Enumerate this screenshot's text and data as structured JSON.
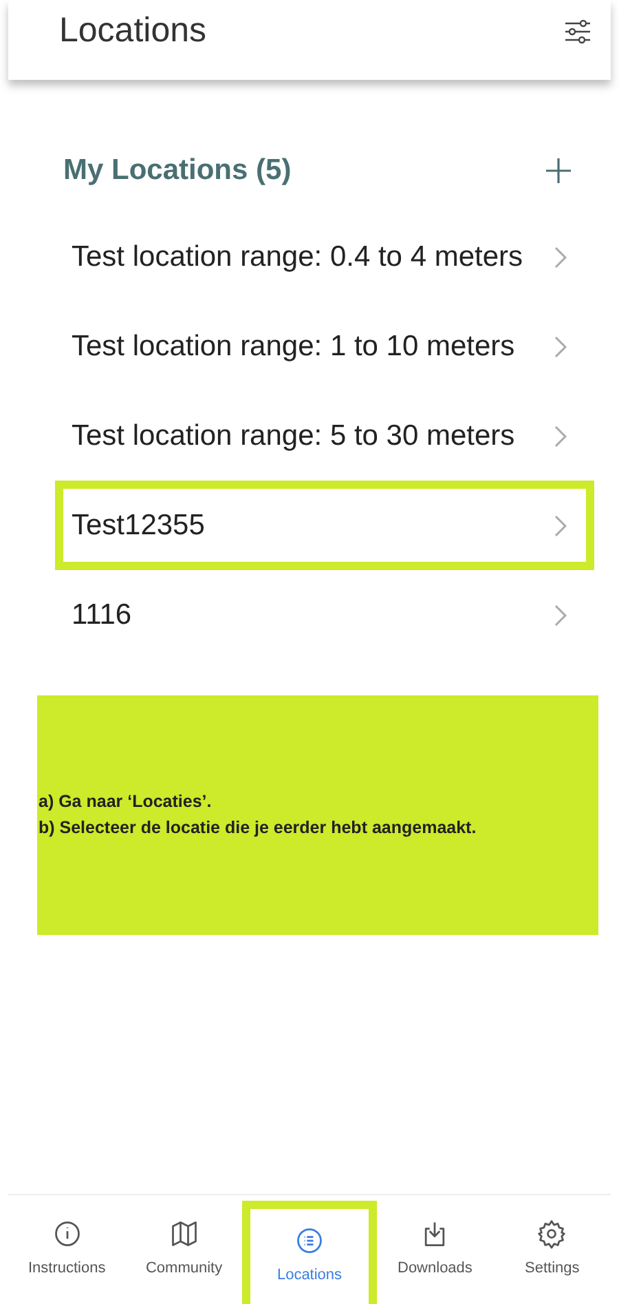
{
  "header": {
    "title": "Locations"
  },
  "section": {
    "title": "My Locations (5)"
  },
  "locations": [
    {
      "name": "Test location range: 0.4 to 4 meters",
      "highlighted": false
    },
    {
      "name": "Test location range: 1 to 10 meters",
      "highlighted": false
    },
    {
      "name": "Test location range: 5 to 30 meters",
      "highlighted": false
    },
    {
      "name": "Test12355",
      "highlighted": true
    },
    {
      "name": "1116",
      "highlighted": false
    }
  ],
  "callout": {
    "lines": [
      "a) Ga naar ‘Locaties’.",
      "b) Selecteer de locatie die je eerder hebt aangemaakt."
    ]
  },
  "nav": [
    {
      "label": "Instructions",
      "kind": "info",
      "selected": false,
      "highlighted": false
    },
    {
      "label": "Community",
      "kind": "map",
      "selected": false,
      "highlighted": false
    },
    {
      "label": "Locations",
      "kind": "list",
      "selected": true,
      "highlighted": true
    },
    {
      "label": "Downloads",
      "kind": "download",
      "selected": false,
      "highlighted": false
    },
    {
      "label": "Settings",
      "kind": "gear",
      "selected": false,
      "highlighted": false
    }
  ]
}
